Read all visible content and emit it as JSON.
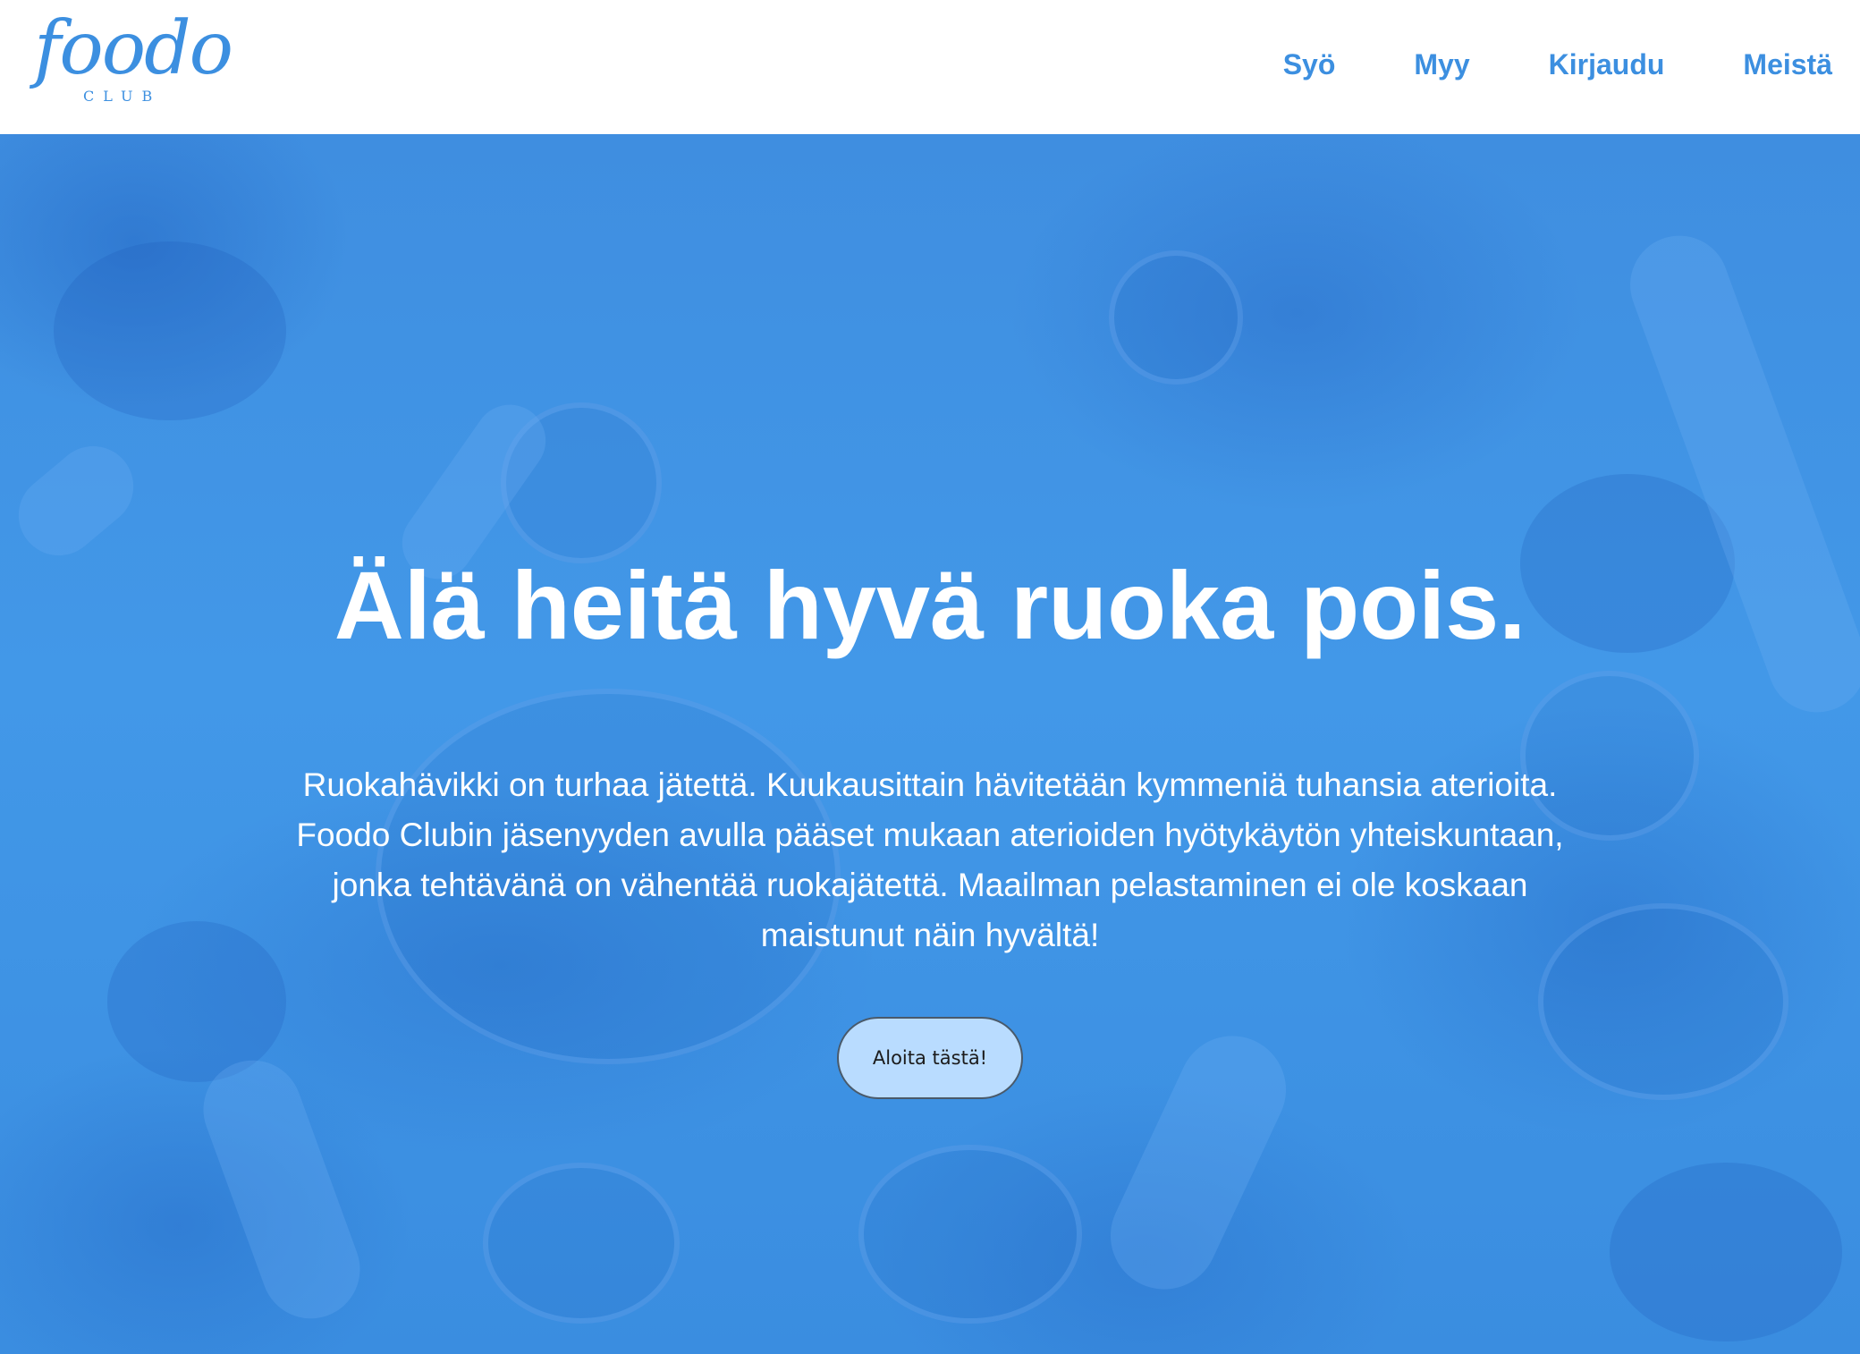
{
  "header": {
    "logo": {
      "word": "foodo",
      "subtitle": "CLUB"
    },
    "nav": [
      {
        "label": "Syö"
      },
      {
        "label": "Myy"
      },
      {
        "label": "Kirjaudu"
      },
      {
        "label": "Meistä"
      }
    ]
  },
  "hero": {
    "headline": "Älä heitä hyvä ruoka pois.",
    "intro": "Ruokahävikki on turhaa jätettä. Kuukausittain hävitetään kymmeniä tuhansia aterioita. Foodo Clubin jäsenyyden avulla pääset mukaan aterioiden hyötykäytön yhteiskuntaan, jonka tehtävänä on vähentää ruokajätettä. Maailman pelastaminen ei ole koskaan maistunut näin hyvältä!",
    "cta_label": "Aloita tästä!",
    "background_image": "people-sharing-food-table-photo"
  },
  "colors": {
    "brand": "#3c8fe0",
    "hero_overlay": "#4298e8",
    "cta_background": "#b9dcff",
    "text_on_hero": "#ffffff"
  }
}
